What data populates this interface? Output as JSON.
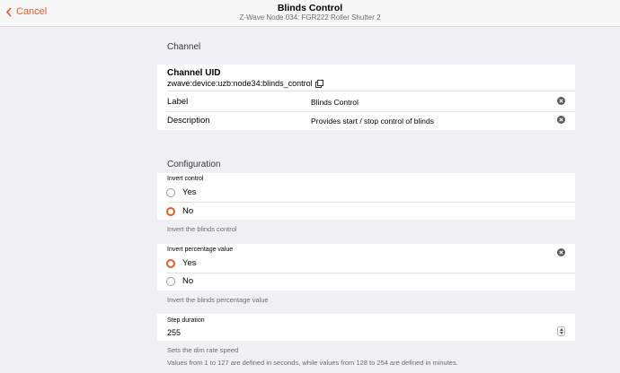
{
  "navbar": {
    "back_label": "Cancel",
    "title": "Blinds Control",
    "subtitle": "Z-Wave Node 034: FGR222 Roller Shutter 2"
  },
  "channel": {
    "section_title": "Channel",
    "uid_label": "Channel UID",
    "uid_value": "zwave:device:uzb:node34:blinds_control",
    "label_name": "Label",
    "label_value": "Blinds Control",
    "description_name": "Description",
    "description_value": "Provides start / stop control of blinds"
  },
  "configuration": {
    "section_title": "Configuration",
    "invert_control": {
      "label": "Invert control",
      "options": [
        "Yes",
        "No"
      ],
      "selected": "No",
      "hint": "Invert the blinds control"
    },
    "invert_percentage": {
      "label": "Invert percentage value",
      "options": [
        "Yes",
        "No"
      ],
      "selected": "Yes",
      "hint": "Invert the blinds percentage value"
    },
    "step_duration": {
      "label": "Step duration",
      "value": "255",
      "hint1": "Sets the dim rate speed",
      "hint2": "Values from 1 to 127 are defined in seconds, while values from 128 to 254 are defined in minutes."
    }
  },
  "colors": {
    "accent": "#e25b2a",
    "background": "#efeff4"
  },
  "icons": {
    "back": "chevron-left-icon",
    "copy": "copy-icon",
    "clear": "clear-circle-icon",
    "stepper": "stepper-icon"
  }
}
